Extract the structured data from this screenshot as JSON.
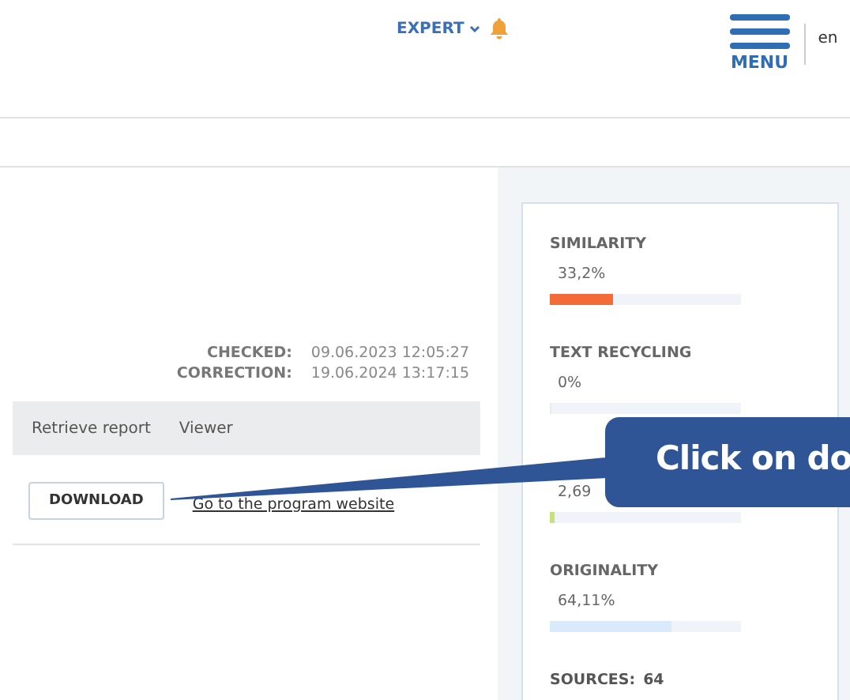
{
  "header": {
    "account": "EXPERT",
    "menu_label": "MENU",
    "language": "en"
  },
  "dates": [
    {
      "label": "CHECKED:",
      "value": "09.06.2023 12:05:27"
    },
    {
      "label": "CORRECTION:",
      "value": "19.06.2024 13:17:15"
    }
  ],
  "report_menu": [
    "Retrieve report",
    "Viewer"
  ],
  "download_button": "DOWNLOAD",
  "website_link": "Go to the program website",
  "metrics": [
    {
      "label": "SIMILARITY",
      "value": "33,2%",
      "level": 0.33,
      "color": "#f26b38"
    },
    {
      "label": "TEXT RECYCLING",
      "value": "0%",
      "level": 0
    },
    {
      "value": "2,69",
      "level": 0.027,
      "color": "#c6e17a"
    },
    {
      "label": "ORIGINALITY",
      "value": "64,11%",
      "level": 0.64,
      "color": "#d9ebfa"
    }
  ],
  "sources": {
    "label": "SOURCES:",
    "value": "64"
  },
  "callout": {
    "text": "Click on do"
  }
}
